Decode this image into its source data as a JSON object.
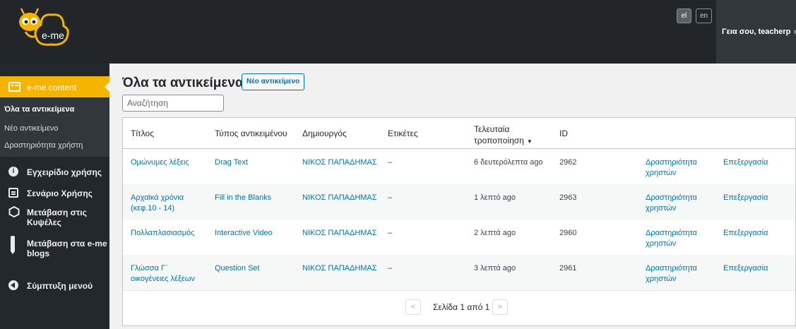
{
  "brand": {
    "logo_text": "e-me",
    "colors": {
      "accent": "#f5b400",
      "link": "#0073aa",
      "sidebar": "#23282d"
    }
  },
  "topbar": {
    "languages": [
      {
        "code": "el",
        "active": true
      },
      {
        "code": "en",
        "active": false
      }
    ],
    "greeting": "Γεια σου, teacherp"
  },
  "sidebar": {
    "current_menu": {
      "label": "e-me content",
      "icon": "content-list-icon"
    },
    "submenu": [
      {
        "label": "Όλα τα αντικείμενα",
        "active": true
      },
      {
        "label": "Νέο αντικείμενο",
        "active": false
      },
      {
        "label": "Δραστηριότητα χρήστη",
        "active": false
      }
    ],
    "items": [
      {
        "label": "Εγχειρίδιο χρήσης",
        "icon": "info-icon"
      },
      {
        "label": "Σενάριο Χρήσης",
        "icon": "document-icon"
      },
      {
        "label_line1": "Μετάβαση στις",
        "label_line2": "Κυψέλες",
        "icon": "hexagon-icon"
      },
      {
        "label_line1": "Μετάβαση στα e-me",
        "label_line2": "blogs",
        "icon": "pen-icon"
      },
      {
        "label": "Σύμπτυξη μενού",
        "icon": "collapse-icon"
      }
    ]
  },
  "main": {
    "title": "Όλα τα αντικείμενα",
    "new_button": "Νέο αντικείμενο",
    "search_placeholder": "Αναζήτηση",
    "table": {
      "headers": {
        "title": "Τίτλος",
        "type": "Τύπος αντικειμένου",
        "author": "Δημιουργός",
        "tags": "Ετικέτες",
        "modified_line1": "Τελευταία",
        "modified_line2": "τροποποίηση",
        "sort_indicator": "▼",
        "id": "ID"
      },
      "rows": [
        {
          "title1": "Ομώνυμες λέξεις",
          "title2": "",
          "type": "Drag Text",
          "author": "ΝΙΚΟΣ ΠΑΠΑΔΗΜΑΣ",
          "tags": "–",
          "modified": "6 δευτερόλεπτα ago",
          "id": "2962",
          "activity1": "Δραστηριότητα",
          "activity2": "χρηστών",
          "edit": "Επεξεργασία"
        },
        {
          "title1": "Αρχαϊκά χρόνια",
          "title2": "(κεφ.10 - 14)",
          "type": "Fill in the Blanks",
          "author": "ΝΙΚΟΣ ΠΑΠΑΔΗΜΑΣ",
          "tags": "–",
          "modified": "1 λεπτό ago",
          "id": "2963",
          "activity1": "Δραστηριότητα",
          "activity2": "χρηστών",
          "edit": "Επεξεργασία"
        },
        {
          "title1": "Πολλαπλασιασμός",
          "title2": "",
          "type": "Interactive Video",
          "author": "ΝΙΚΟΣ ΠΑΠΑΔΗΜΑΣ",
          "tags": "–",
          "modified": "2 λεπτά ago",
          "id": "2960",
          "activity1": "Δραστηριότητα",
          "activity2": "χρηστών",
          "edit": "Επεξεργασία"
        },
        {
          "title1": "Γλώσσα Γ΄",
          "title2": "οικογένειες λέξεων",
          "type": "Question Set",
          "author": "ΝΙΚΟΣ ΠΑΠΑΔΗΜΑΣ",
          "tags": "–",
          "modified": "3 λεπτά ago",
          "id": "2961",
          "activity1": "Δραστηριότητα",
          "activity2": "χρηστών",
          "edit": "Επεξεργασία"
        }
      ]
    },
    "pagination": {
      "prev": "<",
      "next": ">",
      "text": "Σελίδα 1 από 1"
    }
  }
}
